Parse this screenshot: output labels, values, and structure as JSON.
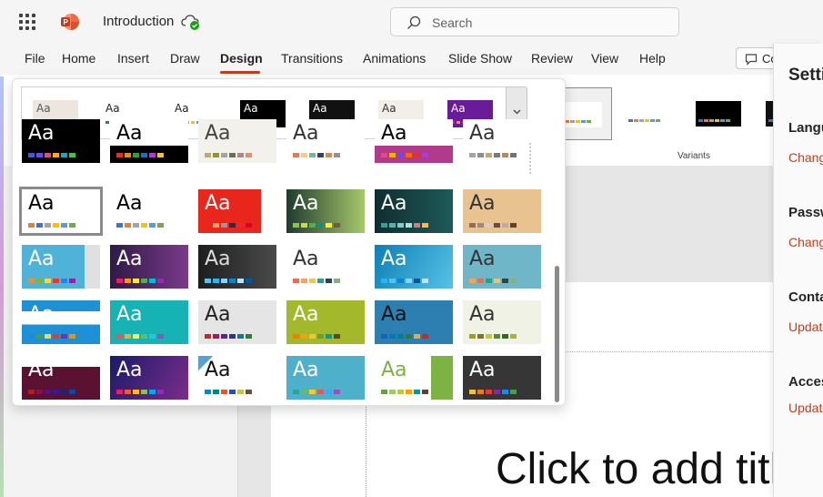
{
  "app": {
    "doc_title": "Introduction",
    "search_placeholder": "Search",
    "comments_label": "Co"
  },
  "menu": [
    "File",
    "Home",
    "Insert",
    "Draw",
    "Design",
    "Transitions",
    "Animations",
    "Slide Show",
    "Review",
    "View",
    "Help"
  ],
  "active_tab": "Design",
  "ribbon": {
    "variants_label": "Variants"
  },
  "settings": {
    "title": "Setti",
    "sections": [
      {
        "heading": "Langu",
        "link": "Chang"
      },
      {
        "heading": "Passw",
        "link": "Chang"
      },
      {
        "heading": "Conta",
        "link": "Updat"
      },
      {
        "heading": "Acces",
        "link": "Updat"
      }
    ]
  },
  "slide": {
    "title_placeholder": "Click to add titl"
  },
  "themes": {
    "aa_label": "Aa",
    "strip": [
      {
        "bg": "#ece6df",
        "fg": "#555",
        "dots": [
          "#b9a99a",
          "#d1c5b8",
          "#9c8b7d",
          "#c8bfb5",
          "#a19487"
        ]
      },
      {
        "bg": "#ffffff",
        "fg": "#222",
        "dots": [
          "#3a7d44",
          "#bfa14a",
          "#8b5e3c",
          "#5a7d9a",
          "#c0504d"
        ]
      },
      {
        "bg": "#ffffff",
        "fg": "#222",
        "dots": [
          "#4472c4",
          "#ed7d31",
          "#a5a5a5",
          "#ffc000",
          "#5b9bd5"
        ]
      },
      {
        "bg": "#000000",
        "fg": "#fff",
        "dots": [
          "#4472c4",
          "#ed7d31",
          "#70ad47",
          "#ffc000",
          "#5b9bd5"
        ]
      },
      {
        "bg": "#111111",
        "fg": "#fff",
        "dots": [
          "#2e75b6",
          "#c00000",
          "#70ad47",
          "#ffc000",
          "#7030a0"
        ]
      },
      {
        "bg": "#f2efe9",
        "fg": "#333",
        "dots": [
          "#8a6d3b",
          "#c9a66b",
          "#6b8e23",
          "#8b4513",
          "#4f6d7a"
        ]
      },
      {
        "bg": "#6a1b9a",
        "fg": "#fff",
        "dots": [
          "#e91e63",
          "#ff9800",
          "#9c27b0",
          "#3f51b5",
          "#ffc107"
        ]
      }
    ],
    "grid": [
      [
        {
          "bg": "#000000",
          "fg": "#fff",
          "dots": [
            "#3b5bdb",
            "#7048e8",
            "#e64980",
            "#fab005",
            "#15aabf",
            "#40c057"
          ]
        },
        {
          "bg": "linear-gradient(#ffffff 0 60%, #000 60% 100%)",
          "fg": "#000",
          "dots": [
            "#e03131",
            "#f08c00",
            "#2f9e44",
            "#1971c2",
            "#ae3ec9",
            "#fcc419"
          ]
        },
        {
          "bg": "#f3f1ec",
          "fg": "#444",
          "dots": [
            "#c2a878",
            "#8d9440",
            "#a3a3a3",
            "#6b705c",
            "#b5838d",
            "#cb997e"
          ]
        },
        {
          "bg": "#ffffff",
          "fg": "#333",
          "dots": [
            "#e07a5f",
            "#f2cc8f",
            "#81b29a",
            "#3d405b",
            "#d08c60",
            "#9a8c98"
          ]
        },
        {
          "bg": "linear-gradient(#ffffff 0 60%, #b23a8a 60% 100%)",
          "fg": "#000",
          "dots": [
            "#e64980",
            "#fab005",
            "#7048e8",
            "#f76707",
            "#e03131",
            "#ae3ec9"
          ]
        },
        {
          "bg": "#ffffff",
          "fg": "#333",
          "dots": [
            "#a5a5a5",
            "#8d8d8d",
            "#c1a57b",
            "#7a7a7a",
            "#b08968",
            "#6c757d"
          ]
        }
      ],
      [
        {
          "bg": "#ffffff",
          "fg": "#000",
          "dots": [
            "#ed7d31",
            "#4472c4",
            "#a5a5a5",
            "#ffc000",
            "#5b9bd5",
            "#70ad47"
          ]
        },
        {
          "bg": "#ffffff",
          "fg": "#000",
          "dots": [
            "#4472c4",
            "#ed7d31",
            "#a5a5a5",
            "#ffc000",
            "#5b9bd5",
            "#70ad47"
          ]
        },
        {
          "bg": "linear-gradient(90deg, #e8261c 0 80%, #fff 80% 100%)",
          "fg": "#fff",
          "dots": [
            "#e8261c",
            "#f4a261",
            "#8d99ae",
            "#2b2d42",
            "#ef233c",
            "#d90429"
          ]
        },
        {
          "bg": "linear-gradient(90deg, #1f3b2e, #a7c96b)",
          "fg": "#fff",
          "dots": [
            "#8bc34a",
            "#cddc39",
            "#4caf50",
            "#009688",
            "#ffeb3b",
            "#795548"
          ]
        },
        {
          "bg": "linear-gradient(90deg, #0f2d2f, #1f5a5a)",
          "fg": "#fff",
          "dots": [
            "#26a69a",
            "#4db6ac",
            "#80cbc4",
            "#b2dfdb",
            "#e57373",
            "#ffb74d"
          ]
        },
        {
          "bg": "#e9c38f",
          "fg": "#333",
          "dots": [
            "#8d6e63",
            "#a1887f",
            "#d7ccc8",
            "#6d4c41",
            "#bcaaa4",
            "#5d4037"
          ]
        }
      ],
      [
        {
          "bg": "linear-gradient(90deg, #4fb3d9 0 80%, #e0e0e0 80% 100%)",
          "fg": "#fff",
          "dots": [
            "#f28c28",
            "#7cb342",
            "#fdd835",
            "#e53935",
            "#1e88e5",
            "#8e24aa"
          ]
        },
        {
          "bg": "linear-gradient(90deg, #2e1a47, #7a3a8a)",
          "fg": "#fff",
          "dots": [
            "#e91e63",
            "#ff9800",
            "#ffeb3b",
            "#4caf50",
            "#00bcd4",
            "#9c27b0"
          ]
        },
        {
          "bg": "linear-gradient(90deg, #1e1e1e, #4a4a4a)",
          "fg": "#ddd",
          "dots": [
            "#4fc3f7",
            "#29b6f6",
            "#81d4fa",
            "#0288d1",
            "#b3e5fc",
            "#01579b"
          ]
        },
        {
          "bg": "#ffffff",
          "fg": "#333",
          "dots": [
            "#e76f51",
            "#f4a261",
            "#e9c46a",
            "#2a9d8f",
            "#264653",
            "#8ab17d"
          ]
        },
        {
          "bg": "linear-gradient(120deg, #0e7fb5, #55c2e6)",
          "fg": "#fff",
          "dots": [
            "#29b6f6",
            "#4fc3f7",
            "#0288d1",
            "#81d4fa",
            "#01579b",
            "#b3e5fc"
          ]
        },
        {
          "bg": "#6fb7c8",
          "fg": "#333",
          "dots": [
            "#f4a261",
            "#e76f51",
            "#2a9d8f",
            "#e9c46a",
            "#264653",
            "#8ab17d"
          ]
        }
      ],
      [
        {
          "bg": "linear-gradient(#1e90d6 0 25%, #fff 25% 55%, #1e90d6 55% 100%)",
          "fg": "#fff",
          "dots": [
            "#1e88e5",
            "#43a047",
            "#fdd835",
            "#e53935",
            "#8e24aa",
            "#fb8c00"
          ]
        },
        {
          "bg": "#17b2b4",
          "fg": "#fff",
          "dots": [
            "#ef5350",
            "#ffa726",
            "#ffee58",
            "#66bb6a",
            "#26c6da",
            "#ab47bc"
          ]
        },
        {
          "bg": "#e5e5e5",
          "fg": "#222",
          "dots": [
            "#c62828",
            "#ad1457",
            "#6a1b9a",
            "#283593",
            "#00838f",
            "#2e7d32"
          ]
        },
        {
          "bg": "#a3b82a",
          "fg": "#fff",
          "dots": [
            "#f57c00",
            "#ffa000",
            "#fbc02d",
            "#689f38",
            "#0097a7",
            "#5d4037"
          ]
        },
        {
          "bg": "#2c7fb0",
          "fg": "#111",
          "dots": [
            "#1565c0",
            "#0277bd",
            "#00838f",
            "#2e7d32",
            "#f9a825",
            "#c62828"
          ]
        },
        {
          "bg": "#f0f2e6",
          "fg": "#333",
          "dots": [
            "#9e9d24",
            "#827717",
            "#c0ca33",
            "#558b2f",
            "#33691e",
            "#afb42b"
          ]
        }
      ],
      [
        {
          "bg": "linear-gradient(#ffffff 0 25%, #5a1230 25% 100%)",
          "fg": "#fff",
          "dots": [
            "#b71c1c",
            "#880e4f",
            "#4a148c",
            "#311b92",
            "#1a237e",
            "#0d47a1"
          ]
        },
        {
          "bg": "linear-gradient(120deg, #1a1a6a, #7b2d8a)",
          "fg": "#fff",
          "dots": [
            "#e91e63",
            "#ff5722",
            "#ffc107",
            "#8bc34a",
            "#03a9f4",
            "#9c27b0"
          ]
        },
        {
          "bg": "linear-gradient(135deg, #5aa0d0 0 12%, #fff 12% 100%)",
          "fg": "#111",
          "dots": [
            "#0288d1",
            "#00897b",
            "#f4511e",
            "#3949ab",
            "#c0ca33",
            "#6d4c41"
          ]
        },
        {
          "bg": "#4fb0cc",
          "fg": "#fff",
          "dots": [
            "#26a69a",
            "#66bb6a",
            "#ffca28",
            "#ef5350",
            "#42a5f5",
            "#ab47bc"
          ]
        },
        {
          "bg": "linear-gradient(90deg, #ffffff 0 72%, #7cb342 72% 100%)",
          "fg": "#7cb342",
          "dots": [
            "#689f38",
            "#9ccc65",
            "#c0ca33",
            "#ffa000",
            "#0097a7",
            "#5d4037"
          ]
        },
        {
          "bg": "#363636",
          "fg": "#fff",
          "dots": [
            "#fbc02d",
            "#f57c00",
            "#e53935",
            "#8e24aa",
            "#1e88e5",
            "#43a047"
          ]
        }
      ]
    ]
  },
  "variants": [
    {
      "bg": "#ffffff",
      "dots": [
        "#4472c4",
        "#ed7d31",
        "#a5a5a5",
        "#ffc000",
        "#5b9bd5",
        "#70ad47"
      ]
    },
    {
      "bg": "#ffffff",
      "dots": [
        "#4472c4",
        "#ed7d31",
        "#a5a5a5",
        "#ffc000",
        "#5b9bd5",
        "#70ad47"
      ]
    },
    {
      "bg": "#000000",
      "dots": [
        "#4472c4",
        "#ed7d31",
        "#a5a5a5",
        "#ffc000",
        "#5b9bd5",
        "#70ad47"
      ]
    },
    {
      "bg": "#111111",
      "dots": [
        "#4472c4",
        "#ed7d31",
        "#a5a5a5",
        "#ffc000",
        "#5b9bd5",
        "#70ad47"
      ]
    }
  ],
  "colors": {
    "accent": "#c43e1c",
    "selected_outline": "#8a8a8a"
  }
}
